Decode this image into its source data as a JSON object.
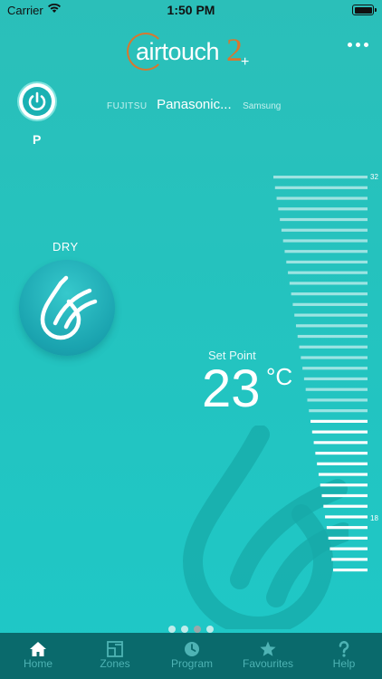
{
  "status_bar": {
    "carrier": "Carrier",
    "time": "1:50 PM"
  },
  "app": {
    "logo_text": "airtouch",
    "logo_number": "2",
    "logo_plus": "+"
  },
  "power": {
    "label": "P"
  },
  "brands": {
    "left": "FUJITSU",
    "selected": "Panasonic...",
    "right": "Samsung"
  },
  "mode": {
    "label": "DRY",
    "icon": "water-drop-icon"
  },
  "set_point": {
    "label": "Set Point",
    "value": "23",
    "unit": "°C"
  },
  "temperature_scale": {
    "max_label": "32",
    "min_label": "18",
    "set_value": 23
  },
  "pager": {
    "pages": 4,
    "active_index": 2
  },
  "tabs": [
    {
      "label": "Home",
      "icon": "home-icon",
      "active": true
    },
    {
      "label": "Zones",
      "icon": "zones-icon",
      "active": false
    },
    {
      "label": "Program",
      "icon": "clock-icon",
      "active": false
    },
    {
      "label": "Favourites",
      "icon": "star-icon",
      "active": false
    },
    {
      "label": "Help",
      "icon": "question-icon",
      "active": false
    }
  ],
  "colors": {
    "accent": "#d9772f",
    "tab_bar": "#0a6a6c",
    "background": "#24c3bf"
  }
}
